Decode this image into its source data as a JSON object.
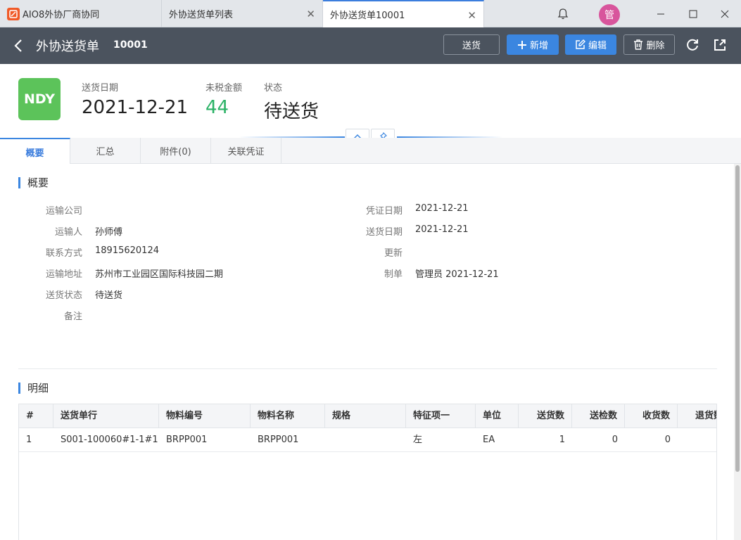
{
  "window": {
    "tabs": [
      {
        "label": "AIO8外协厂商协同"
      },
      {
        "label": "外协送货单列表"
      },
      {
        "label": "外协送货单10001"
      }
    ],
    "user_avatar": "管"
  },
  "header": {
    "title": "外协送货单",
    "doc_no": "10001",
    "btn_deliver": "送货",
    "btn_add": "新增",
    "btn_edit": "编辑",
    "btn_delete": "删除"
  },
  "summary": {
    "badge": "NDY",
    "date_label": "送货日期",
    "date_value": "2021-12-21",
    "amount_label": "未税金额",
    "amount_value": "44",
    "status_label": "状态",
    "status_value": "待送货"
  },
  "subtabs": [
    "概要",
    "汇总",
    "附件(0)",
    "关联凭证"
  ],
  "overview": {
    "title": "概要",
    "left": [
      {
        "label": "运输公司",
        "value": ""
      },
      {
        "label": "运输人",
        "value": "孙师傅"
      },
      {
        "label": "联系方式",
        "value": "18915620124"
      },
      {
        "label": "运输地址",
        "value": "苏州市工业园区国际科技园二期"
      },
      {
        "label": "送货状态",
        "value": "待送货"
      },
      {
        "label": "备注",
        "value": ""
      }
    ],
    "right": [
      {
        "label": "凭证日期",
        "value": "2021-12-21"
      },
      {
        "label": "送货日期",
        "value": "2021-12-21"
      },
      {
        "label": "更新",
        "value": ""
      },
      {
        "label": "制单",
        "value": "管理员 2021-12-21"
      }
    ]
  },
  "detail": {
    "title": "明细",
    "columns": [
      "#",
      "送货单行",
      "物料编号",
      "物料名称",
      "规格",
      "特征项一",
      "单位",
      "送货数",
      "送检数",
      "收货数",
      "退货数"
    ],
    "rows": [
      [
        "1",
        "S001-100060#1-1#1",
        "BRPP001",
        "BRPP001",
        "",
        "左",
        "EA",
        "1",
        "0",
        "0",
        ""
      ]
    ]
  },
  "colors": {
    "header_bg": "#4b535e",
    "primary": "#3b86e0",
    "badge_green": "#5cc35a",
    "amount_green": "#2bb266",
    "avatar_pink": "#d8559c"
  }
}
